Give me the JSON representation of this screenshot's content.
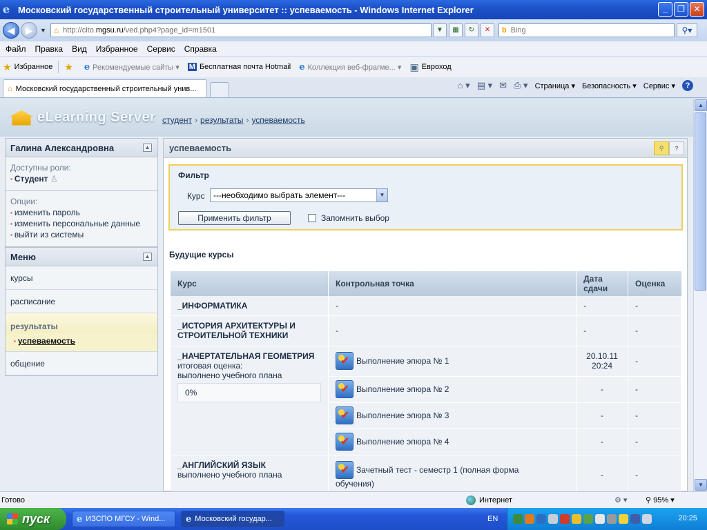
{
  "window": {
    "title": "Московский государственный строительный университет :: успеваемость - Windows Internet Explorer"
  },
  "address": {
    "url_prefix": "http://cito.",
    "url_host": "mgsu.ru",
    "url_path": "/ved.php4?page_id=m1501",
    "search_placeholder": "Bing"
  },
  "menu": [
    "Файл",
    "Правка",
    "Вид",
    "Избранное",
    "Сервис",
    "Справка"
  ],
  "favorites": {
    "label": "Избранное",
    "items": [
      "Рекомендуемые сайты ▾",
      "Бесплатная почта Hotmail",
      "Коллекция веб-фрагме... ▾",
      "Евроход"
    ]
  },
  "tab": {
    "title": "Московский государственный строительный унив..."
  },
  "commands": {
    "page": "Страница ▾",
    "security": "Безопасность ▾",
    "tools": "Сервис ▾"
  },
  "site": {
    "logo": "eLearning Server",
    "breadcrumb": [
      "студент",
      "результаты",
      "успеваемость"
    ]
  },
  "sidebar": {
    "user": "Галина  Александровна",
    "roles_label": "Доступны роли:",
    "role": "Студент",
    "options_label": "Опции:",
    "options": [
      "изменить пароль",
      "изменить персональные данные",
      "выйти из системы"
    ],
    "menu_title": "Меню",
    "nav": [
      "курсы",
      "расписание"
    ],
    "active_section": "результаты",
    "active_sub": "успеваемость",
    "nav_after": "общение"
  },
  "main": {
    "title": "успеваемость",
    "filter": {
      "title": "Фильтр",
      "course_label": "Курс",
      "course_value": "---необходимо выбрать элемент---",
      "apply_label": "Применить фильтр",
      "remember_label": "Запомнить выбор"
    },
    "section_title": "Будущие курсы",
    "columns": {
      "course": "Курс",
      "checkpoint": "Контрольная точка",
      "date_l1": "Дата",
      "date_l2": "сдачи",
      "grade": "Оценка"
    },
    "rows": [
      {
        "course": "_ИНФОРМАТИКА",
        "checkpoint": "-",
        "date": "-",
        "grade": "-"
      },
      {
        "course": "_ИСТОРИЯ АРХИТЕКТУРЫ И СТРОИТЕЛЬНОЙ ТЕХНИКИ",
        "checkpoint": "-",
        "date": "-",
        "grade": "-"
      }
    ],
    "geometry": {
      "course": "_НАЧЕРТАТЕЛЬНАЯ ГЕОМЕТРИЯ",
      "note1": "итоговая оценка:",
      "note2": "выполнено учебного плана",
      "percent": "0%",
      "items": [
        {
          "name": "Выполнение эпюра № 1",
          "date1": "20.10.11",
          "date2": "20:24",
          "grade": "-"
        },
        {
          "name": "Выполнение эпюра № 2",
          "date": "-",
          "grade": "-"
        },
        {
          "name": "Выполнение эпюра № 3",
          "date": "-",
          "grade": "-"
        },
        {
          "name": "Выполнение эпюра № 4",
          "date": "-",
          "grade": "-"
        }
      ]
    },
    "english": {
      "course": "_АНГЛИЙСКИЙ ЯЗЫК",
      "note": "выполнено учебного плана",
      "item": "Зачетный тест - семестр 1 (полная форма",
      "item2": "обучения)",
      "date": "-",
      "grade": "-"
    }
  },
  "status": {
    "ready": "Готово",
    "zone": "Интернет",
    "zoom": "95%"
  },
  "taskbar": {
    "start": "пуск",
    "tasks": [
      "ИЗСПО МГСУ - Wind...",
      "Московский государ..."
    ],
    "lang": "EN",
    "clock": "20:25"
  }
}
